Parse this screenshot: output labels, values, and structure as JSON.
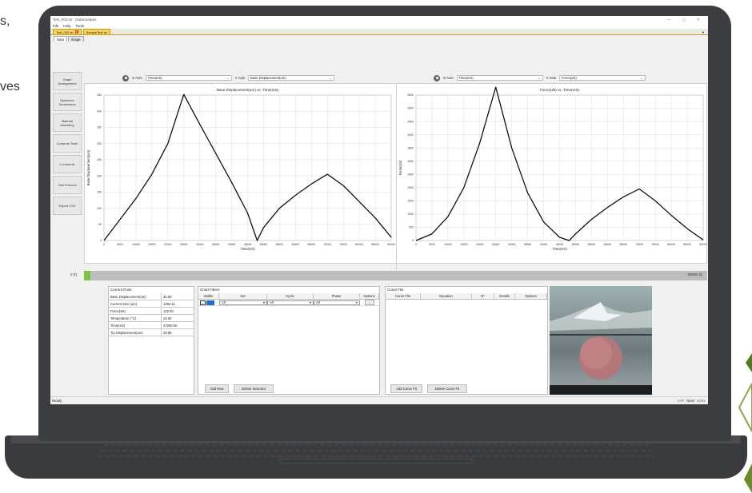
{
  "background_text": {
    "line1": "s,",
    "line2": "ves"
  },
  "window": {
    "title": "Test_002.txt - DataAnalysis",
    "minimize": "—",
    "maximize": "◻",
    "close": "✕"
  },
  "menu": [
    "File",
    "Help",
    "Tools"
  ],
  "file_tabs": [
    {
      "label": "Test_002.txt",
      "close": "x"
    },
    {
      "label": "SampleTest.txt"
    }
  ],
  "view_tabs": [
    "Data",
    "Image"
  ],
  "nav_buttons": [
    "Graph Arrangement",
    "Specimen Dimensions",
    "Material Modelling",
    "Compute Tools",
    "Comments",
    "Test Protocol",
    "Export CSV"
  ],
  "charts": {
    "left": {
      "x_axis_label": "X Axis",
      "x_axis_value": "Time(mS)",
      "y_axis_label": "Y Axis",
      "y_axis_value": "Base Displacement(um)"
    },
    "right": {
      "x_axis_label": "X Axis",
      "x_axis_value": "Time(mS)",
      "y_axis_label": "Y Axis",
      "y_axis_value": "Force(uN)"
    }
  },
  "chart_data": [
    {
      "type": "line",
      "title": "Base Displacement(um) vs. Time(mS)",
      "xlabel": "Time(mS)",
      "ylabel": "Base Displacement(um)",
      "xlim": [
        0,
        90000
      ],
      "ylim": [
        0,
        450
      ],
      "xticks": [
        0,
        5000,
        10000,
        15000,
        20000,
        25000,
        30000,
        35000,
        40000,
        45000,
        50000,
        55000,
        60000,
        65000,
        70000,
        75000,
        80000,
        85000,
        90000
      ],
      "yticks": [
        0,
        50,
        100,
        150,
        200,
        250,
        300,
        350,
        400,
        450
      ],
      "grid": true,
      "series": [
        {
          "x": [
            0,
            5000,
            10000,
            15000,
            20000,
            25000,
            30000,
            35000,
            40000,
            45000,
            48000,
            50000,
            55000,
            60000,
            65000,
            70000,
            75000,
            80000,
            85000,
            90000
          ],
          "y": [
            0,
            65,
            130,
            205,
            300,
            452,
            360,
            270,
            180,
            85,
            0,
            40,
            100,
            140,
            175,
            205,
            170,
            120,
            70,
            10
          ]
        }
      ]
    },
    {
      "type": "line",
      "title": "Force(uN) vs. Time(mS)",
      "xlabel": "Time(mS)",
      "ylabel": "Force(uN)",
      "xlim": [
        0,
        90000
      ],
      "ylim": [
        0,
        5500
      ],
      "xticks": [
        0,
        5000,
        10000,
        15000,
        20000,
        25000,
        30000,
        35000,
        40000,
        45000,
        50000,
        55000,
        60000,
        65000,
        70000,
        75000,
        80000,
        85000,
        90000
      ],
      "yticks": [
        0,
        500,
        1000,
        1500,
        2000,
        2500,
        3000,
        3500,
        4000,
        4500,
        5000,
        5500
      ],
      "grid": true,
      "series": [
        {
          "x": [
            0,
            5000,
            10000,
            15000,
            20000,
            25000,
            30000,
            35000,
            40000,
            45000,
            48000,
            50000,
            55000,
            60000,
            65000,
            70000,
            75000,
            80000,
            85000,
            90000
          ],
          "y": [
            0,
            250,
            900,
            2000,
            3700,
            5800,
            3500,
            1800,
            700,
            120,
            0,
            250,
            800,
            1250,
            1650,
            1950,
            1500,
            950,
            450,
            20
          ]
        }
      ]
    }
  ],
  "progress": {
    "left_label": "0 (t)",
    "right_label": "90000 (t)",
    "fraction": 0.01
  },
  "current_point": {
    "title": "Current Point",
    "rows": [
      {
        "k": "Base Displacement(um)",
        "v": "32.80"
      },
      {
        "k": "Current Size (um)",
        "v": "1294.11"
      },
      {
        "k": "Force(uN)",
        "v": "122.00"
      },
      {
        "k": "Temperature (°C)",
        "v": "24.00"
      },
      {
        "k": "Time(mS)",
        "v": "47000.00"
      },
      {
        "k": "Tip Displacement(um)",
        "v": "28.88"
      }
    ]
  },
  "chart_filters": {
    "title": "Chart Filters",
    "headers": [
      "Visible",
      "Set",
      "Cycle",
      "Phase",
      "Options"
    ],
    "row": {
      "set": "All",
      "cycle": "All",
      "phase": "All",
      "options": "..."
    },
    "add_button": "Add Row",
    "delete_button": "Delete Selected"
  },
  "curve_fits": {
    "title": "Curve Fits",
    "headers": [
      "Curve Fits",
      "Equation",
      "R²",
      "Details",
      "Options"
    ],
    "add_button": "Add Curve Fit",
    "delete_button": "Delete Curve Fit"
  },
  "status": {
    "left": "Ready",
    "cap": "CAP",
    "num": "NUM",
    "scrl": "SCRL"
  },
  "colors": {
    "accent_tab": "#f7d565",
    "progress_fill": "#7ec342",
    "leaf_green": "#6a8b2a"
  }
}
